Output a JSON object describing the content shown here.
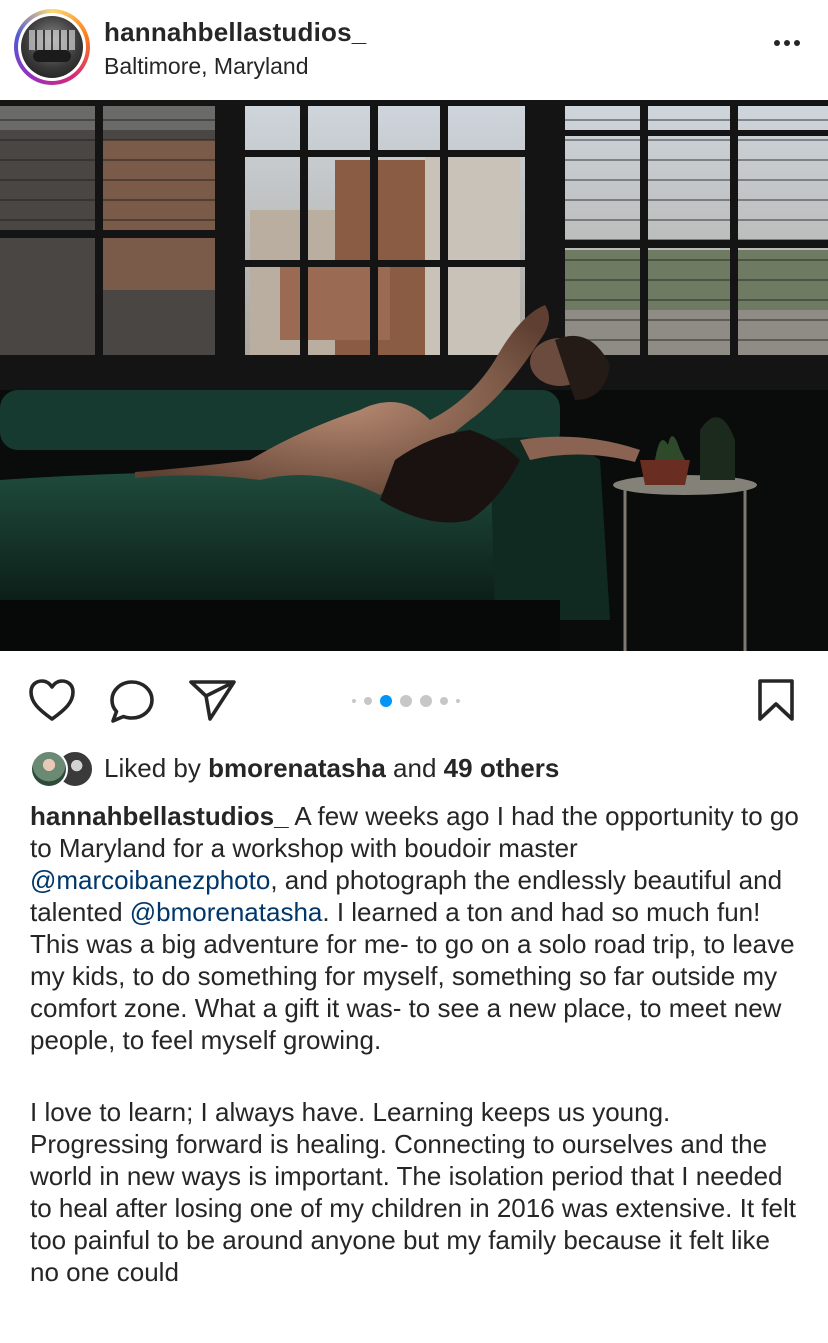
{
  "post": {
    "username": "hannahbellastudios_",
    "location": "Baltimore, Maryland"
  },
  "icons": {
    "more": "more-horizontal-icon",
    "like": "heart-icon",
    "comment": "comment-icon",
    "share": "paper-plane-icon",
    "save": "bookmark-icon"
  },
  "carousel": {
    "count": 7,
    "active_index": 2
  },
  "likes": {
    "prefix": "Liked by",
    "user": "bmorenatasha",
    "conjunction": "and",
    "others": "49 others"
  },
  "caption": {
    "author": "hannahbellastudios_",
    "p1_a": " A few weeks ago I had the opportunity to go to Maryland for a workshop with boudoir master ",
    "mention1": "@marcoibanezphoto",
    "p1_b": ", and photograph the endlessly beautiful and talented ",
    "mention2": "@bmorenatasha",
    "p1_c": ". I learned a ton and had so much fun! This was a big adventure for me- to go on a solo road trip, to leave my kids, to do something for myself, something so far outside my comfort zone. What a gift it was- to see a new place, to meet new people, to feel myself growing.",
    "p2": "I love to learn; I always have. Learning keeps us young. Progressing forward is healing. Connecting to ourselves and the world in new ways is important. The isolation period that I needed to heal after losing one of my children in 2016 was extensive. It felt too painful to be around anyone but my family because it felt like no one could"
  },
  "colors": {
    "text": "#262626",
    "mention": "#00376b",
    "active_dot": "#0095f6",
    "inactive_dot": "#c7c7c7"
  }
}
